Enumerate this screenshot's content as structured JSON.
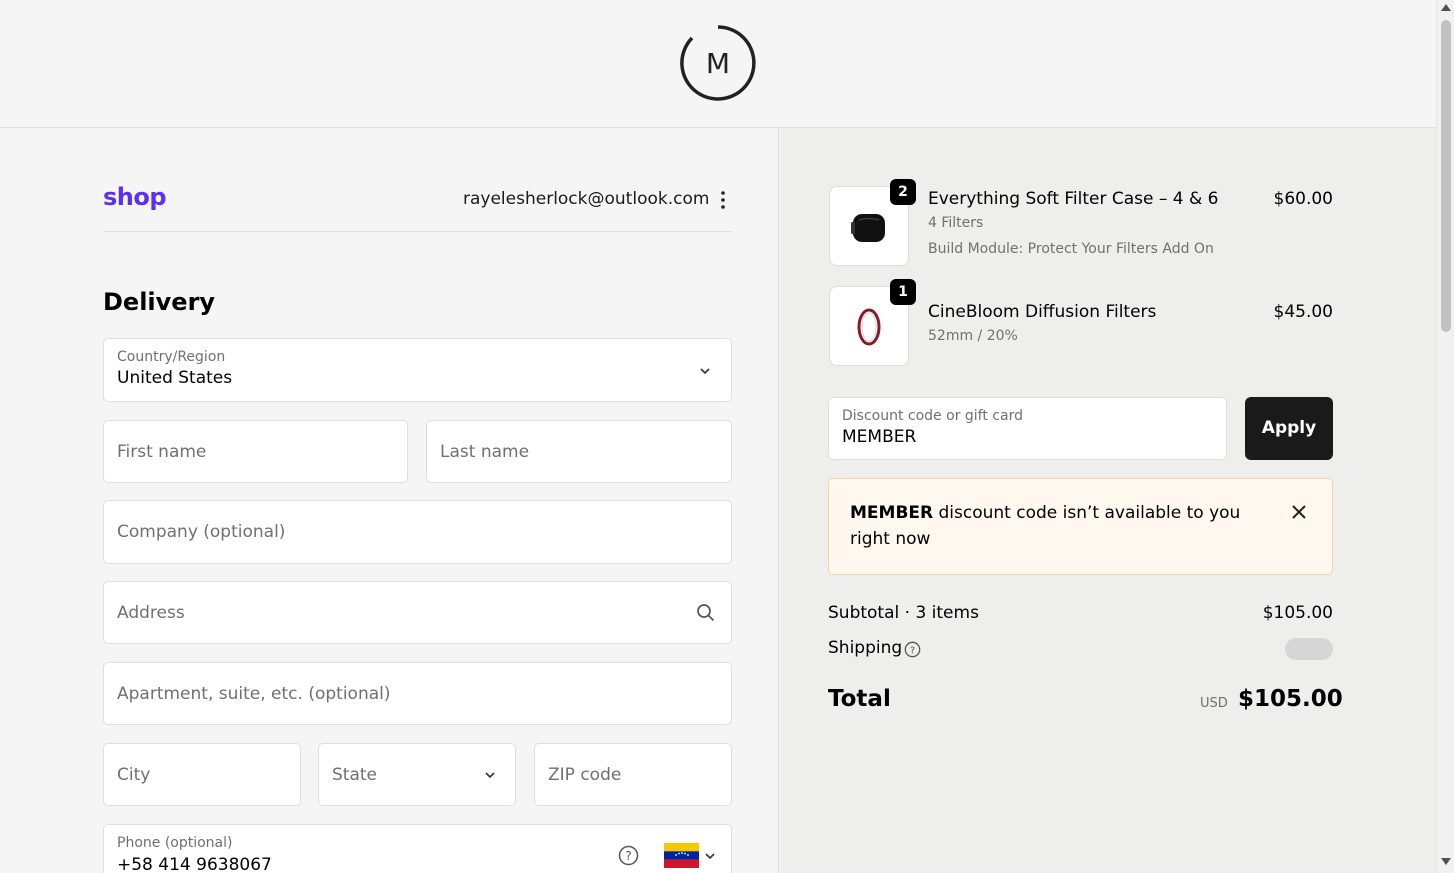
{
  "header": {
    "logo_letter": "M"
  },
  "account": {
    "shop_logo": "shop",
    "email": "rayelesherlock@outlook.com"
  },
  "delivery": {
    "title": "Delivery",
    "country": {
      "label": "Country/Region",
      "value": "United States"
    },
    "first_name": {
      "placeholder": "First name"
    },
    "last_name": {
      "placeholder": "Last name"
    },
    "company": {
      "placeholder": "Company (optional)"
    },
    "address": {
      "placeholder": "Address"
    },
    "apartment": {
      "placeholder": "Apartment, suite, etc. (optional)"
    },
    "city": {
      "placeholder": "City"
    },
    "state": {
      "placeholder": "State"
    },
    "zip": {
      "placeholder": "ZIP code"
    },
    "phone": {
      "label": "Phone (optional)",
      "value": "+58 414 9638067",
      "flag": "venezuela-flag"
    }
  },
  "order": {
    "items": [
      {
        "qty": "2",
        "name": "Everything Soft Filter Case – 4 & 6",
        "variant": "4 Filters",
        "addon": "Build Module: Protect Your Filters Add On",
        "price": "$60.00",
        "thumb_icon": "filter-case-icon"
      },
      {
        "qty": "1",
        "name": "CineBloom Diffusion Filters",
        "variant": "52mm / 20%",
        "price": "$45.00",
        "thumb_icon": "filter-ring-icon"
      }
    ],
    "discount": {
      "label": "Discount code or gift card",
      "value": "MEMBER",
      "apply_label": "Apply"
    },
    "alert": {
      "code": "MEMBER",
      "message": " discount code isn’t available to you right now"
    },
    "subtotal_label": "Subtotal · 3 items",
    "subtotal_value": "$105.00",
    "shipping_label": "Shipping",
    "total_label": "Total",
    "currency": "USD",
    "total_value": "$105.00"
  },
  "colors": {
    "shop_brand": "#5a31f4",
    "apply_button": "#1a1a1a",
    "alert_bg": "#fff8ee"
  }
}
